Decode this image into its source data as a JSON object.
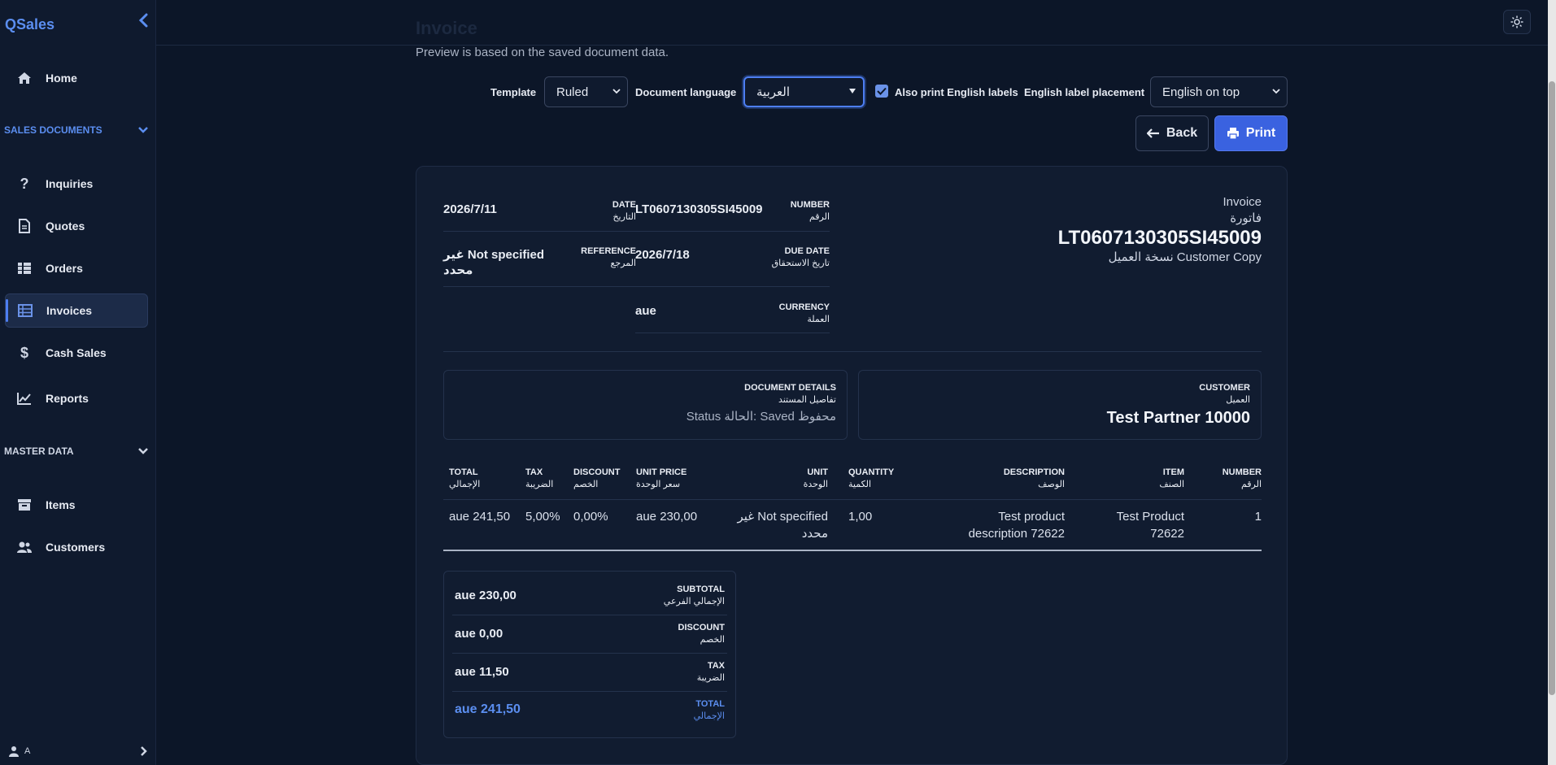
{
  "app": {
    "brand": "QSales"
  },
  "sidebar": {
    "home": "Home",
    "sales_section": "SALES DOCUMENTS",
    "inquiries": "Inquiries",
    "quotes": "Quotes",
    "orders": "Orders",
    "invoices": "Invoices",
    "cash_sales": "Cash Sales",
    "reports": "Reports",
    "master_section": "MASTER DATA",
    "items": "Items",
    "customers": "Customers",
    "user": "A"
  },
  "page": {
    "title": "Invoice",
    "preview_note": "Preview is based on the saved document data."
  },
  "controls": {
    "template_label": "Template",
    "template_value": "Ruled",
    "language_label": "Document language",
    "language_value": "العربية",
    "english_labels_label": "Also print English labels",
    "english_labels_checked": true,
    "placement_label": "English label placement",
    "placement_value": "English on top",
    "back_label": "Back",
    "print_label": "Print"
  },
  "document": {
    "meta": {
      "date_key_en": "DATE",
      "date_key_ar": "التاريخ",
      "date_val": "2026/7/11",
      "number_key_en": "NUMBER",
      "number_key_ar": "الرقم",
      "number_val": "LT0607130305SI45009",
      "reference_key_en": "REFERENCE",
      "reference_key_ar": "المرجع",
      "reference_val": "غير Not specified محدد",
      "due_key_en": "DUE DATE",
      "due_key_ar": "تاريخ الاستحقاق",
      "due_val": "2026/7/18",
      "currency_key_en": "CURRENCY",
      "currency_key_ar": "العملة",
      "currency_val": "aue"
    },
    "heading": {
      "type_en": "Invoice",
      "type_ar": "فاتورة",
      "number": "LT0607130305SI45009",
      "copy": "نسخة العميل Customer Copy"
    },
    "details": {
      "key_en": "DOCUMENT DETAILS",
      "key_ar": "تفاصيل المستند",
      "status": "Status الحالة: Saved محفوظ"
    },
    "customer": {
      "key_en": "CUSTOMER",
      "key_ar": "العميل",
      "name": "Test Partner 10000"
    },
    "table": {
      "headers": [
        {
          "en": "TOTAL",
          "ar": "الإجمالي"
        },
        {
          "en": "TAX",
          "ar": "الضريبة"
        },
        {
          "en": "DISCOUNT",
          "ar": "الخصم"
        },
        {
          "en": "UNIT PRICE",
          "ar": "سعر الوحدة"
        },
        {
          "en": "UNIT",
          "ar": "الوحدة"
        },
        {
          "en": "QUANTITY",
          "ar": "الكمية"
        },
        {
          "en": "DESCRIPTION",
          "ar": "الوصف"
        },
        {
          "en": "ITEM",
          "ar": "الصنف"
        },
        {
          "en": "NUMBER",
          "ar": "الرقم"
        }
      ],
      "row": {
        "total": "aue 241,50",
        "tax": "5,00%",
        "discount": "0,00%",
        "unit_price": "aue 230,00",
        "unit": "غير Not specified محدد",
        "quantity": "1,00",
        "description": "Test product description 72622",
        "item": "Test Product 72622",
        "number": "1"
      }
    },
    "totals": {
      "subtotal_en": "SUBTOTAL",
      "subtotal_ar": "الإجمالي الفرعي",
      "subtotal_val": "aue 230,00",
      "discount_en": "DISCOUNT",
      "discount_ar": "الخصم",
      "discount_val": "aue 0,00",
      "tax_en": "TAX",
      "tax_ar": "الضريبة",
      "tax_val": "aue 11,50",
      "total_en": "TOTAL",
      "total_ar": "الإجمالي",
      "total_val": "aue 241,50"
    }
  },
  "colors": {
    "accent": "#3a62e0",
    "brand": "#5b8ef0",
    "background": "#0c1628"
  }
}
